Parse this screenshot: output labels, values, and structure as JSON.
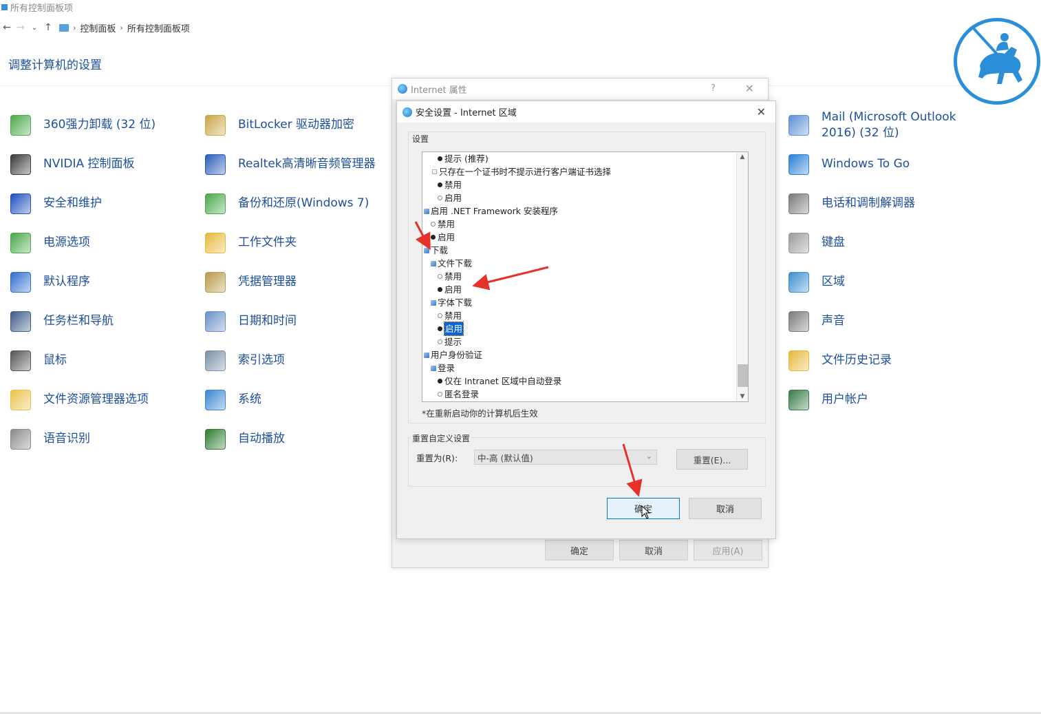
{
  "window": {
    "title": "所有控制面板项"
  },
  "address": {
    "crumbs": [
      "控制面板",
      "所有控制面板项"
    ]
  },
  "page": {
    "title": "调整计算机的设置"
  },
  "columns": {
    "col1": [
      {
        "label": "360强力卸载 (32 位)",
        "icon": "uninstall-icon",
        "color": "#4aa84a"
      },
      {
        "label": "NVIDIA 控制面板",
        "icon": "nvidia-icon",
        "color": "#3a3a3a"
      },
      {
        "label": "安全和维护",
        "icon": "flag-icon",
        "color": "#1f4fbf"
      },
      {
        "label": "电源选项",
        "icon": "power-icon",
        "color": "#4aa84a"
      },
      {
        "label": "默认程序",
        "icon": "default-programs-icon",
        "color": "#2f6fd0"
      },
      {
        "label": "任务栏和导航",
        "icon": "taskbar-icon",
        "color": "#3e5c8a"
      },
      {
        "label": "鼠标",
        "icon": "mouse-icon",
        "color": "#555555"
      },
      {
        "label": "文件资源管理器选项",
        "icon": "folder-options-icon",
        "color": "#e9c24a"
      },
      {
        "label": "语音识别",
        "icon": "microphone-icon",
        "color": "#8a8a8a"
      }
    ],
    "col2": [
      {
        "label": "BitLocker 驱动器加密",
        "icon": "key-icon",
        "color": "#c9a646"
      },
      {
        "label": "Realtek高清晰音频管理器",
        "icon": "audio-manager-icon",
        "color": "#2a5bb8"
      },
      {
        "label": "备份和还原(Windows 7)",
        "icon": "backup-icon",
        "color": "#4aa84a"
      },
      {
        "label": "工作文件夹",
        "icon": "work-folders-icon",
        "color": "#e7b93c"
      },
      {
        "label": "凭据管理器",
        "icon": "credential-icon",
        "color": "#b89a4a"
      },
      {
        "label": "日期和时间",
        "icon": "clock-icon",
        "color": "#6a8fc8"
      },
      {
        "label": "索引选项",
        "icon": "index-search-icon",
        "color": "#7a8fa8"
      },
      {
        "label": "系统",
        "icon": "system-icon",
        "color": "#3a86d0"
      },
      {
        "label": "自动播放",
        "icon": "autoplay-icon",
        "color": "#2e7d32"
      }
    ],
    "col3": [
      {
        "label": "Mail (Microsoft Outlook 2016) (32 位)",
        "icon": "mail-icon",
        "color": "#5b8fd6"
      },
      {
        "label": "Windows To Go",
        "icon": "windows-to-go-icon",
        "color": "#2a7fd6"
      },
      {
        "label": "电话和调制解调器",
        "icon": "phone-modem-icon",
        "color": "#7a7a7a"
      },
      {
        "label": "键盘",
        "icon": "keyboard-icon",
        "color": "#9a9a9a"
      },
      {
        "label": "区域",
        "icon": "region-globe-icon",
        "color": "#3a8fd0"
      },
      {
        "label": "声音",
        "icon": "speaker-icon",
        "color": "#7a7a7a"
      },
      {
        "label": "文件历史记录",
        "icon": "file-history-icon",
        "color": "#e7b93c"
      },
      {
        "label": "用户帐户",
        "icon": "user-accounts-icon",
        "color": "#3a7a4a"
      }
    ]
  },
  "internet_options": {
    "title": "Internet 属性",
    "help": "?",
    "buttons": {
      "ok": "确定",
      "cancel": "取消",
      "apply": "应用(A)"
    }
  },
  "security_dialog": {
    "title": "安全设置 - Internet 区域",
    "settings_group": "设置",
    "tree": [
      {
        "kind": "radio",
        "checked": true,
        "label": "提示 (推荐)"
      },
      {
        "kind": "check",
        "checked": false,
        "label": "只存在一个证书时不提示进行客户端证书选择"
      },
      {
        "kind": "radio",
        "checked": true,
        "label": "禁用"
      },
      {
        "kind": "radio",
        "checked": false,
        "label": "启用"
      },
      {
        "kind": "node",
        "label": "启用 .NET Framework 安装程序"
      },
      {
        "kind": "radio",
        "checked": false,
        "label": "禁用"
      },
      {
        "kind": "radio",
        "checked": true,
        "label": "启用"
      },
      {
        "kind": "node",
        "label": "下载"
      },
      {
        "kind": "node",
        "label": "文件下载"
      },
      {
        "kind": "radio",
        "checked": false,
        "label": "禁用"
      },
      {
        "kind": "radio",
        "checked": true,
        "label": "启用"
      },
      {
        "kind": "node",
        "label": "字体下载"
      },
      {
        "kind": "radio",
        "checked": false,
        "label": "禁用"
      },
      {
        "kind": "radio",
        "checked": true,
        "label": "启用",
        "selected": true
      },
      {
        "kind": "radio",
        "checked": false,
        "label": "提示"
      },
      {
        "kind": "node",
        "label": "用户身份验证"
      },
      {
        "kind": "node",
        "label": "登录"
      },
      {
        "kind": "radio",
        "checked": true,
        "label": "仅在 Intranet 区域中自动登录"
      },
      {
        "kind": "radio",
        "checked": false,
        "label": "匿名登录"
      }
    ],
    "restart_note": "*在重新启动你的计算机后生效",
    "reset_group": "重置自定义设置",
    "reset_label": "重置为(R):",
    "reset_value": "中-高 (默认值)",
    "reset_button": "重置(E)...",
    "ok": "确定",
    "cancel": "取消"
  },
  "colors": {
    "link_blue": "#1d4e9e",
    "annotation_red": "#e8302a",
    "selection_blue": "#0a64d8",
    "logo_blue": "#2a8fd8"
  }
}
